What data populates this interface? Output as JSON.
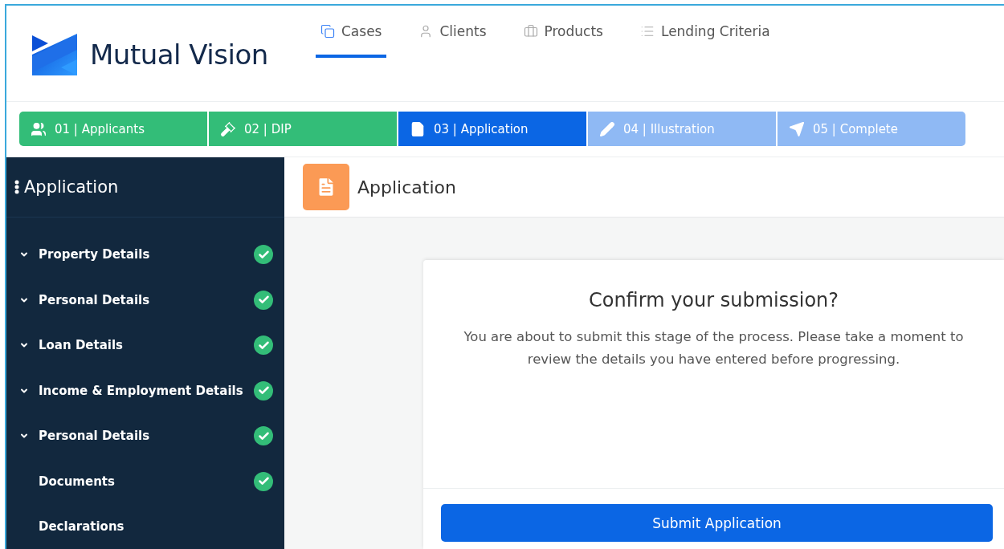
{
  "brand": {
    "name": "Mutual Vision"
  },
  "nav": [
    {
      "label": "Cases",
      "selected": true
    },
    {
      "label": "Clients",
      "selected": false
    },
    {
      "label": "Products",
      "selected": false
    },
    {
      "label": "Lending Criteria",
      "selected": false
    }
  ],
  "steps": [
    {
      "label": "01 | Applicants",
      "done": true,
      "selected": false
    },
    {
      "label": "02 | DIP",
      "done": true,
      "selected": false
    },
    {
      "label": "03 | Application",
      "done": false,
      "selected": true
    },
    {
      "label": "04 | Illustration",
      "done": false,
      "selected": false
    },
    {
      "label": "05 | Complete",
      "done": false,
      "selected": false
    }
  ],
  "sidebar": {
    "title": "Application",
    "items": [
      {
        "label": "Property Details",
        "expandable": true,
        "complete": true
      },
      {
        "label": "Personal Details",
        "expandable": true,
        "complete": true
      },
      {
        "label": "Loan Details",
        "expandable": true,
        "complete": true
      },
      {
        "label": "Income & Employment Details",
        "expandable": true,
        "complete": true
      },
      {
        "label": "Personal Details",
        "expandable": true,
        "complete": true
      },
      {
        "label": "Documents",
        "expandable": false,
        "complete": true
      },
      {
        "label": "Declarations",
        "expandable": false,
        "complete": false
      }
    ]
  },
  "page": {
    "title": "Application"
  },
  "dialog": {
    "title": "Confirm your submission?",
    "message": "You are about to submit this stage of the process. Please take a moment to review the details you have entered before progressing.",
    "button": "Submit Application"
  }
}
